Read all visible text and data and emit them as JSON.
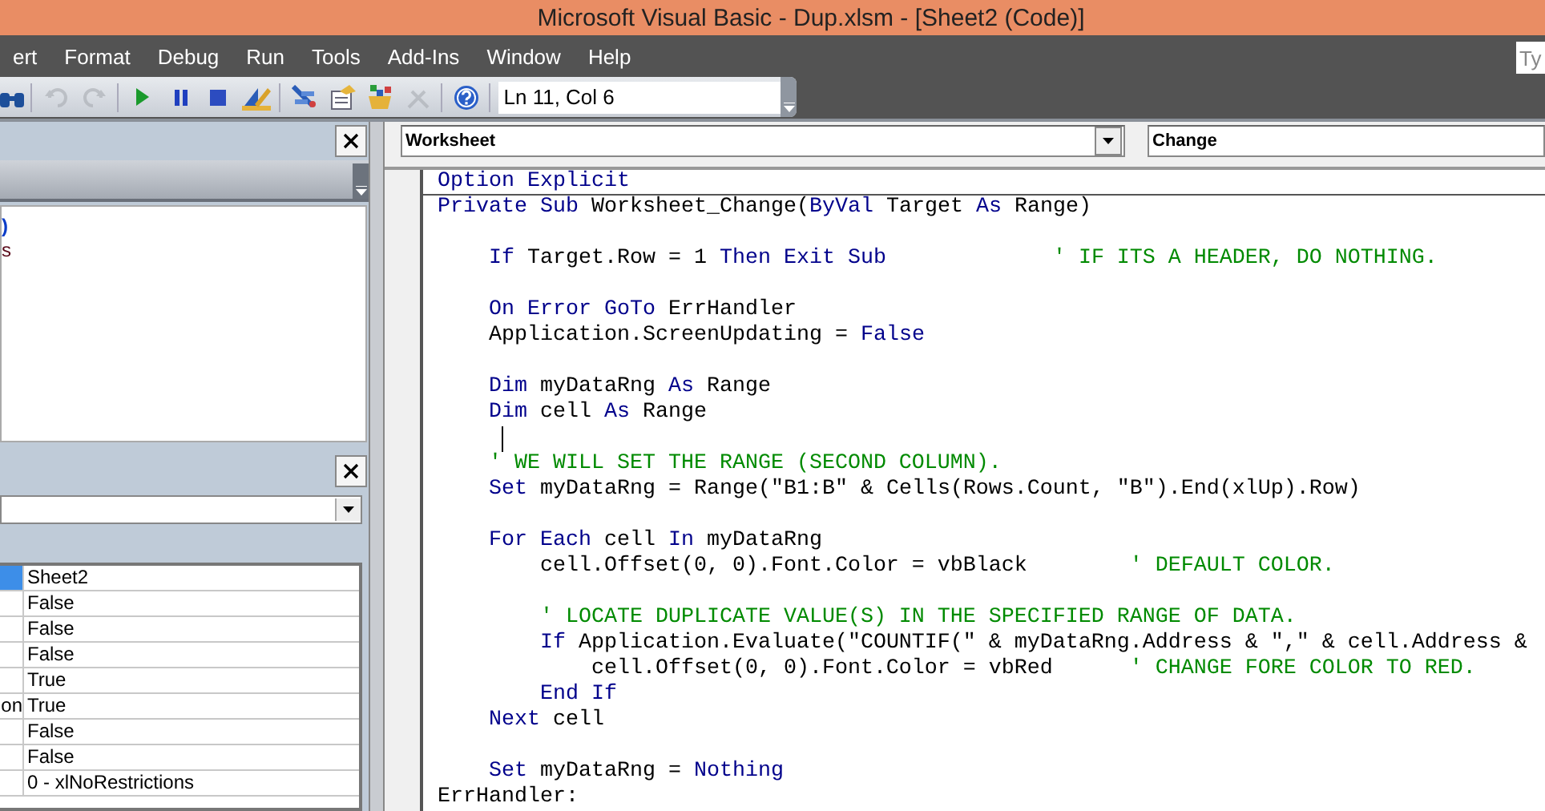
{
  "window": {
    "title": "Microsoft Visual Basic - Dup.xlsm - [Sheet2 (Code)]"
  },
  "menu": [
    {
      "label": "ert"
    },
    {
      "label": "Format"
    },
    {
      "label": "Debug"
    },
    {
      "label": "Run"
    },
    {
      "label": "Tools"
    },
    {
      "label": "Add-Ins"
    },
    {
      "label": "Window"
    },
    {
      "label": "Help"
    }
  ],
  "help_search": {
    "placeholder": "Ty"
  },
  "toolbar": {
    "buttons": [
      {
        "kind": "find",
        "disabled": false
      },
      {
        "kind": "undo",
        "disabled": true
      },
      {
        "kind": "redo",
        "disabled": true
      },
      {
        "kind": "run",
        "disabled": false
      },
      {
        "kind": "pause",
        "disabled": false
      },
      {
        "kind": "stop",
        "disabled": false
      },
      {
        "kind": "design",
        "disabled": false
      },
      {
        "kind": "explorer",
        "disabled": false
      },
      {
        "kind": "properties",
        "disabled": false
      },
      {
        "kind": "browser",
        "disabled": false
      },
      {
        "kind": "toolbox",
        "disabled": true
      },
      {
        "kind": "help",
        "disabled": false
      }
    ],
    "position": "Ln 11, Col 6"
  },
  "project_panel": {
    "items": [
      {
        "text": ")",
        "kind": "project"
      },
      {
        "text": "s",
        "kind": "folder"
      }
    ]
  },
  "properties_panel": {
    "rows": [
      {
        "value": "Sheet2",
        "selected": true
      },
      {
        "value": "False",
        "selected": false
      },
      {
        "value": "False",
        "selected": false
      },
      {
        "value": "False",
        "selected": false
      },
      {
        "value": "True",
        "selected": false
      },
      {
        "name": "on",
        "value": "True",
        "selected": false
      },
      {
        "value": "False",
        "selected": false
      },
      {
        "value": "False",
        "selected": false
      },
      {
        "value": "0 - xlNoRestrictions",
        "selected": false
      }
    ]
  },
  "code_window": {
    "object": "Worksheet",
    "procedure": "Change",
    "lines": [
      {
        "kind": "code",
        "divider_below": true,
        "cursor": false,
        "segments": [
          {
            "kind": "keyword",
            "text": "Option Explicit"
          }
        ]
      },
      {
        "kind": "code",
        "divider_below": false,
        "cursor": false,
        "segments": [
          {
            "kind": "keyword",
            "text": "Private Sub "
          },
          {
            "kind": "plain",
            "text": "Worksheet_Change("
          },
          {
            "kind": "keyword",
            "text": "ByVal"
          },
          {
            "kind": "plain",
            "text": " Target "
          },
          {
            "kind": "keyword",
            "text": "As"
          },
          {
            "kind": "plain",
            "text": " Range)"
          }
        ]
      },
      {
        "kind": "blank",
        "divider_below": false,
        "cursor": false
      },
      {
        "kind": "code",
        "divider_below": false,
        "cursor": false,
        "segments": [
          {
            "kind": "keyword",
            "text": "    If"
          },
          {
            "kind": "plain",
            "text": " Target.Row = 1 "
          },
          {
            "kind": "keyword",
            "text": "Then Exit Sub"
          },
          {
            "kind": "comment",
            "text": "             ' IF ITS A HEADER, DO NOTHING."
          }
        ]
      },
      {
        "kind": "blank",
        "divider_below": false,
        "cursor": false
      },
      {
        "kind": "code",
        "divider_below": false,
        "cursor": false,
        "segments": [
          {
            "kind": "keyword",
            "text": "    On Error GoTo"
          },
          {
            "kind": "plain",
            "text": " ErrHandler"
          }
        ]
      },
      {
        "kind": "code",
        "divider_below": false,
        "cursor": false,
        "segments": [
          {
            "kind": "plain",
            "text": "    Application.ScreenUpdating = "
          },
          {
            "kind": "keyword",
            "text": "False"
          }
        ]
      },
      {
        "kind": "blank",
        "divider_below": false,
        "cursor": false
      },
      {
        "kind": "code",
        "divider_below": false,
        "cursor": false,
        "segments": [
          {
            "kind": "keyword",
            "text": "    Dim"
          },
          {
            "kind": "plain",
            "text": " myDataRng "
          },
          {
            "kind": "keyword",
            "text": "As"
          },
          {
            "kind": "plain",
            "text": " Range"
          }
        ]
      },
      {
        "kind": "code",
        "divider_below": false,
        "cursor": false,
        "segments": [
          {
            "kind": "keyword",
            "text": "    Dim"
          },
          {
            "kind": "plain",
            "text": " cell "
          },
          {
            "kind": "keyword",
            "text": "As"
          },
          {
            "kind": "plain",
            "text": " Range"
          }
        ]
      },
      {
        "kind": "blank",
        "divider_below": false,
        "cursor": true
      },
      {
        "kind": "code",
        "divider_below": false,
        "cursor": false,
        "segments": [
          {
            "kind": "comment",
            "text": "    ' WE WILL SET THE RANGE (SECOND COLUMN)."
          }
        ]
      },
      {
        "kind": "code",
        "divider_below": false,
        "cursor": false,
        "segments": [
          {
            "kind": "keyword",
            "text": "    Set"
          },
          {
            "kind": "plain",
            "text": " myDataRng = Range(\"B1:B\" & Cells(Rows.Count, \"B\").End(xlUp).Row)"
          }
        ]
      },
      {
        "kind": "blank",
        "divider_below": false,
        "cursor": false
      },
      {
        "kind": "code",
        "divider_below": false,
        "cursor": false,
        "segments": [
          {
            "kind": "keyword",
            "text": "    For Each"
          },
          {
            "kind": "plain",
            "text": " cell "
          },
          {
            "kind": "keyword",
            "text": "In"
          },
          {
            "kind": "plain",
            "text": " myDataRng"
          }
        ]
      },
      {
        "kind": "code",
        "divider_below": false,
        "cursor": false,
        "segments": [
          {
            "kind": "plain",
            "text": "        cell.Offset(0, 0).Font.Color = vbBlack        "
          },
          {
            "kind": "comment",
            "text": "' DEFAULT COLOR."
          }
        ]
      },
      {
        "kind": "blank",
        "divider_below": false,
        "cursor": false
      },
      {
        "kind": "code",
        "divider_below": false,
        "cursor": false,
        "segments": [
          {
            "kind": "comment",
            "text": "        ' LOCATE DUPLICATE VALUE(S) IN THE SPECIFIED RANGE OF DATA."
          }
        ]
      },
      {
        "kind": "code",
        "divider_below": false,
        "cursor": false,
        "segments": [
          {
            "kind": "keyword",
            "text": "        If"
          },
          {
            "kind": "plain",
            "text": " Application.Evaluate(\"COUNTIF(\" & myDataRng.Address & \",\" & cell.Address &"
          }
        ]
      },
      {
        "kind": "code",
        "divider_below": false,
        "cursor": false,
        "segments": [
          {
            "kind": "plain",
            "text": "            cell.Offset(0, 0).Font.Color = vbRed      "
          },
          {
            "kind": "comment",
            "text": "' CHANGE FORE COLOR TO RED."
          }
        ]
      },
      {
        "kind": "code",
        "divider_below": false,
        "cursor": false,
        "segments": [
          {
            "kind": "keyword",
            "text": "        End If"
          }
        ]
      },
      {
        "kind": "code",
        "divider_below": false,
        "cursor": false,
        "segments": [
          {
            "kind": "keyword",
            "text": "    Next"
          },
          {
            "kind": "plain",
            "text": " cell"
          }
        ]
      },
      {
        "kind": "blank",
        "divider_below": false,
        "cursor": false
      },
      {
        "kind": "code",
        "divider_below": false,
        "cursor": false,
        "segments": [
          {
            "kind": "keyword",
            "text": "    Set"
          },
          {
            "kind": "plain",
            "text": " myDataRng = "
          },
          {
            "kind": "keyword",
            "text": "Nothing"
          }
        ]
      },
      {
        "kind": "code",
        "divider_below": false,
        "cursor": false,
        "segments": [
          {
            "kind": "plain",
            "text": "ErrHandler:"
          }
        ]
      }
    ]
  }
}
